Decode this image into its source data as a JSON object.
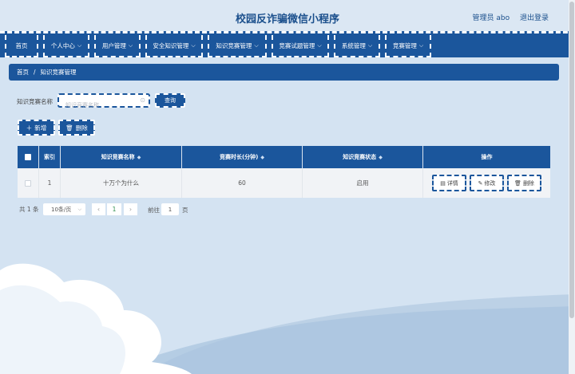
{
  "header": {
    "title": "校园反诈骗微信小程序",
    "user_label": "管理员 abo",
    "logout_label": "退出登录"
  },
  "nav": {
    "items": [
      {
        "label": "首页",
        "has_dropdown": false
      },
      {
        "label": "个人中心",
        "has_dropdown": true
      },
      {
        "label": "用户管理",
        "has_dropdown": true
      },
      {
        "label": "安全知识管理",
        "has_dropdown": true
      },
      {
        "label": "知识竞赛管理",
        "has_dropdown": true
      },
      {
        "label": "竞赛试题管理",
        "has_dropdown": true
      },
      {
        "label": "系统管理",
        "has_dropdown": true
      },
      {
        "label": "竞赛管理",
        "has_dropdown": true
      }
    ]
  },
  "breadcrumb": {
    "home": "首页",
    "separator": "/",
    "current": "知识竞赛管理"
  },
  "search": {
    "label": "知识竞赛名称",
    "placeholder": "知识竞赛名称",
    "value": "",
    "query_button": "查询"
  },
  "actions": {
    "add_label": "新增",
    "delete_label": "删除"
  },
  "table": {
    "headers": {
      "index": "索引",
      "name": "知识竞赛名称",
      "duration": "竞赛时长(分钟)",
      "status": "知识竞赛状态",
      "operation": "操作"
    },
    "rows": [
      {
        "index": "1",
        "name": "十万个为什么",
        "duration": "60",
        "status": "启用"
      }
    ],
    "row_actions": {
      "detail": "详情",
      "edit": "修改",
      "delete": "删除"
    }
  },
  "pagination": {
    "total_label": "共 1 条",
    "page_size": "10条/页",
    "current_page": "1",
    "goto_label": "前往",
    "goto_value": "1",
    "goto_unit": "页"
  },
  "colors": {
    "primary": "#1b569c",
    "background": "#d4e3f2",
    "row_background": "#f1f3f6"
  }
}
